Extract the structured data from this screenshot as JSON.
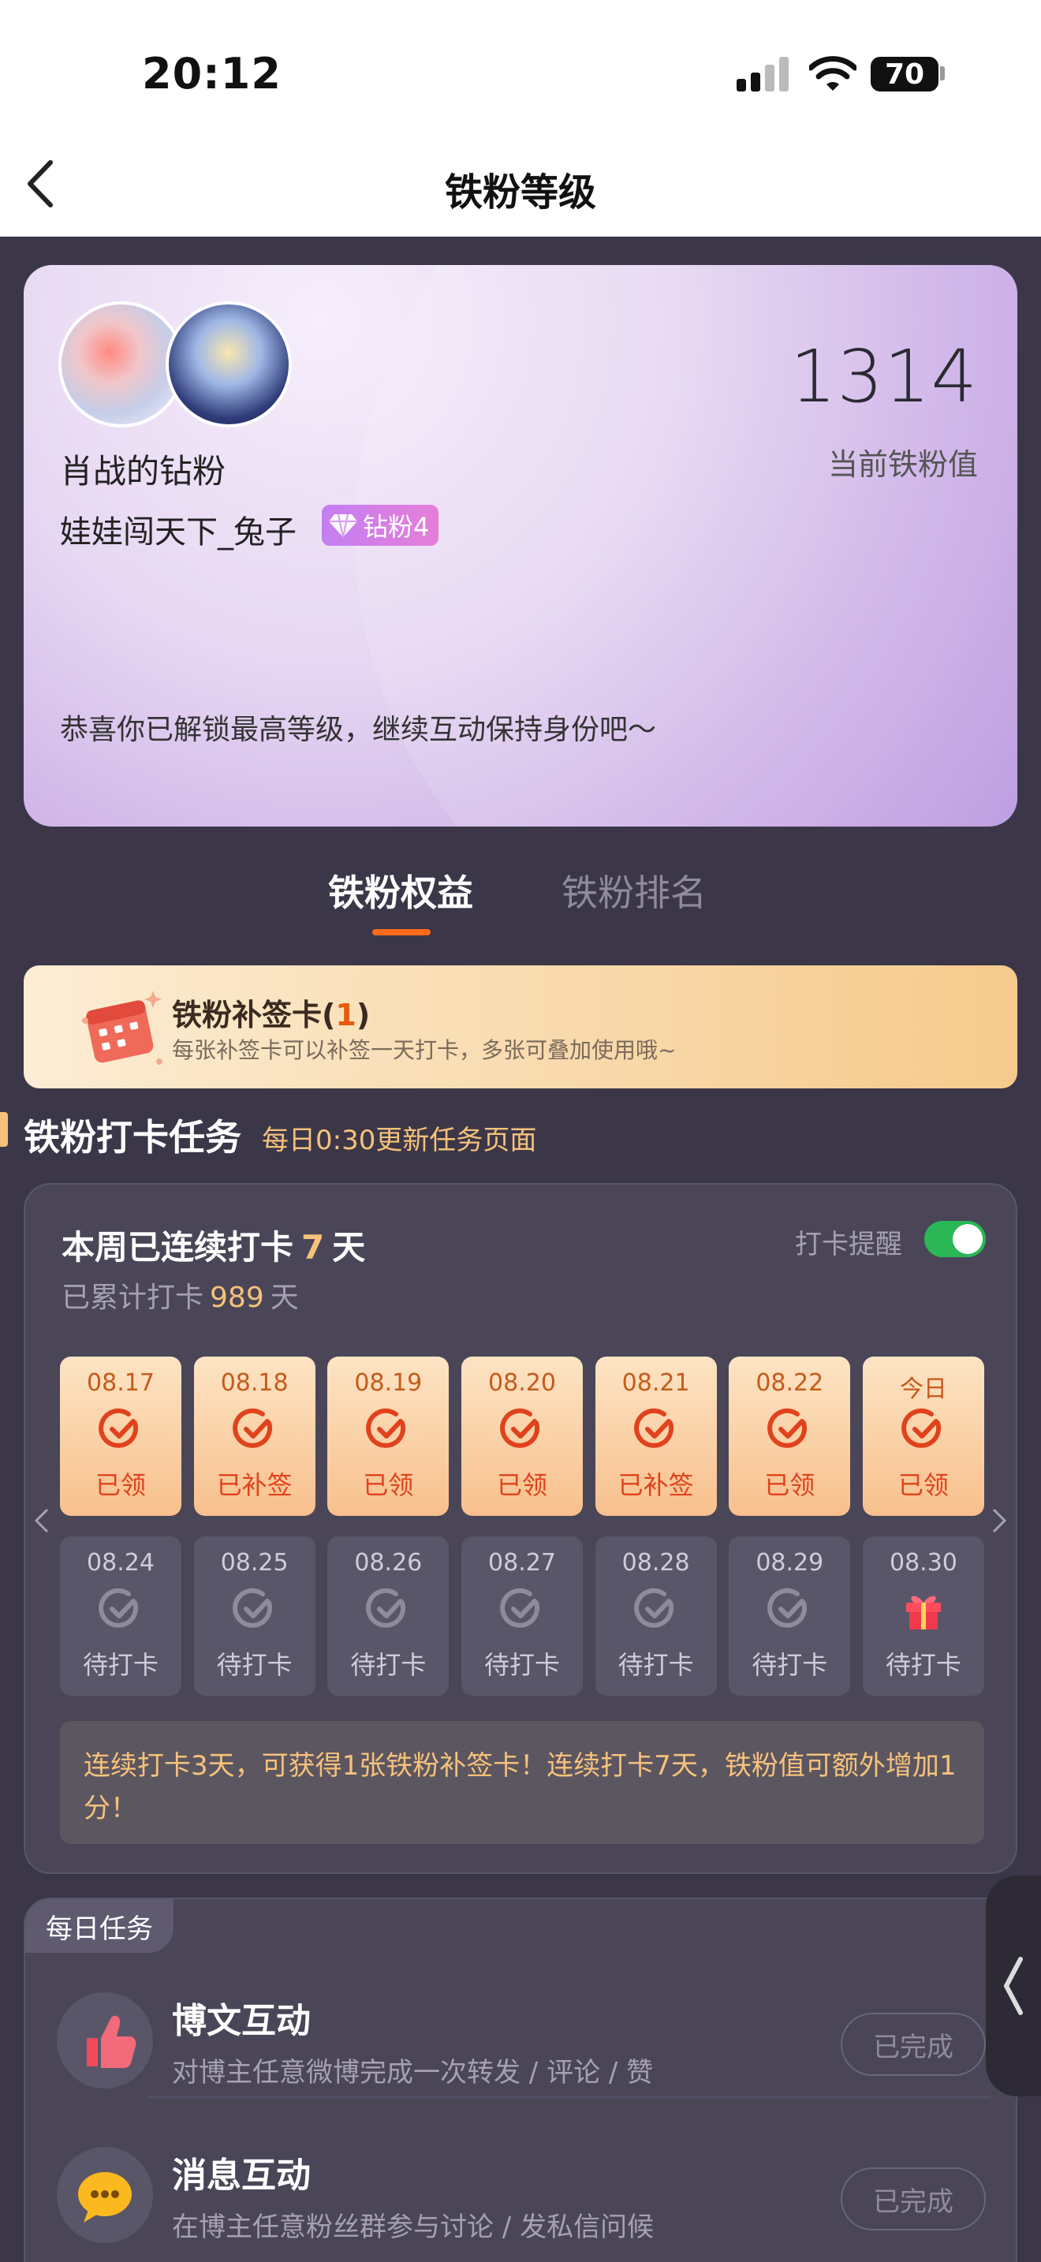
{
  "status_bar": {
    "time": "20:12",
    "battery": "70"
  },
  "nav": {
    "title": "铁粉等级"
  },
  "hero": {
    "name": "肖战的钻粉",
    "username": "娃娃闯天下_兔子",
    "badge": "钻粉4",
    "score": "1314",
    "score_label": "当前铁粉值",
    "message": "恭喜你已解锁最高等级，继续互动保持身份吧～"
  },
  "tabs": [
    {
      "label": "铁粉权益",
      "active": true
    },
    {
      "label": "铁粉排名",
      "active": false
    }
  ],
  "makeup_card": {
    "title": "铁粉补签卡(",
    "count": "1",
    "title_end": ")",
    "desc": "每张补签卡可以补签一天打卡，多张可叠加使用哦~"
  },
  "section": {
    "title": "铁粉打卡任务",
    "subtitle": "每日0:30更新任务页面"
  },
  "checkin": {
    "streak_prefix": "本周已连续打卡",
    "streak_days": "7",
    "streak_suffix": "天",
    "total_prefix": "已累计打卡",
    "total_days": "989",
    "total_suffix": "天",
    "reminder_label": "打卡提醒",
    "reminder_on": true,
    "week1": [
      {
        "date": "08.17",
        "status": "已领"
      },
      {
        "date": "08.18",
        "status": "已补签"
      },
      {
        "date": "08.19",
        "status": "已领"
      },
      {
        "date": "08.20",
        "status": "已领"
      },
      {
        "date": "08.21",
        "status": "已补签"
      },
      {
        "date": "08.22",
        "status": "已领"
      },
      {
        "date": "今日",
        "status": "已领"
      }
    ],
    "week2": [
      {
        "date": "08.24",
        "status": "待打卡"
      },
      {
        "date": "08.25",
        "status": "待打卡"
      },
      {
        "date": "08.26",
        "status": "待打卡"
      },
      {
        "date": "08.27",
        "status": "待打卡"
      },
      {
        "date": "08.28",
        "status": "待打卡"
      },
      {
        "date": "08.29",
        "status": "待打卡"
      },
      {
        "date": "08.30",
        "status": "待打卡",
        "icon": "gift-icon"
      }
    ],
    "tip": "连续打卡3天，可获得1张铁粉补签卡！连续打卡7天，铁粉值可额外增加1分！"
  },
  "daily_tasks": {
    "tag": "每日任务",
    "items": [
      {
        "name": "博文互动",
        "desc": "对博主任意微博完成一次转发 / 评论 / 赞",
        "button": "已完成",
        "icon": "thumbs-up-icon"
      },
      {
        "name": "消息互动",
        "desc": "在博主任意粉丝群参与讨论 / 发私信问候",
        "button": "已完成",
        "icon": "chat-bubble-icon"
      }
    ]
  },
  "colors": {
    "accent": "#f6c27a",
    "orange": "#ff6a1a",
    "toggle": "#2bb756",
    "bg": "#3b3748"
  }
}
